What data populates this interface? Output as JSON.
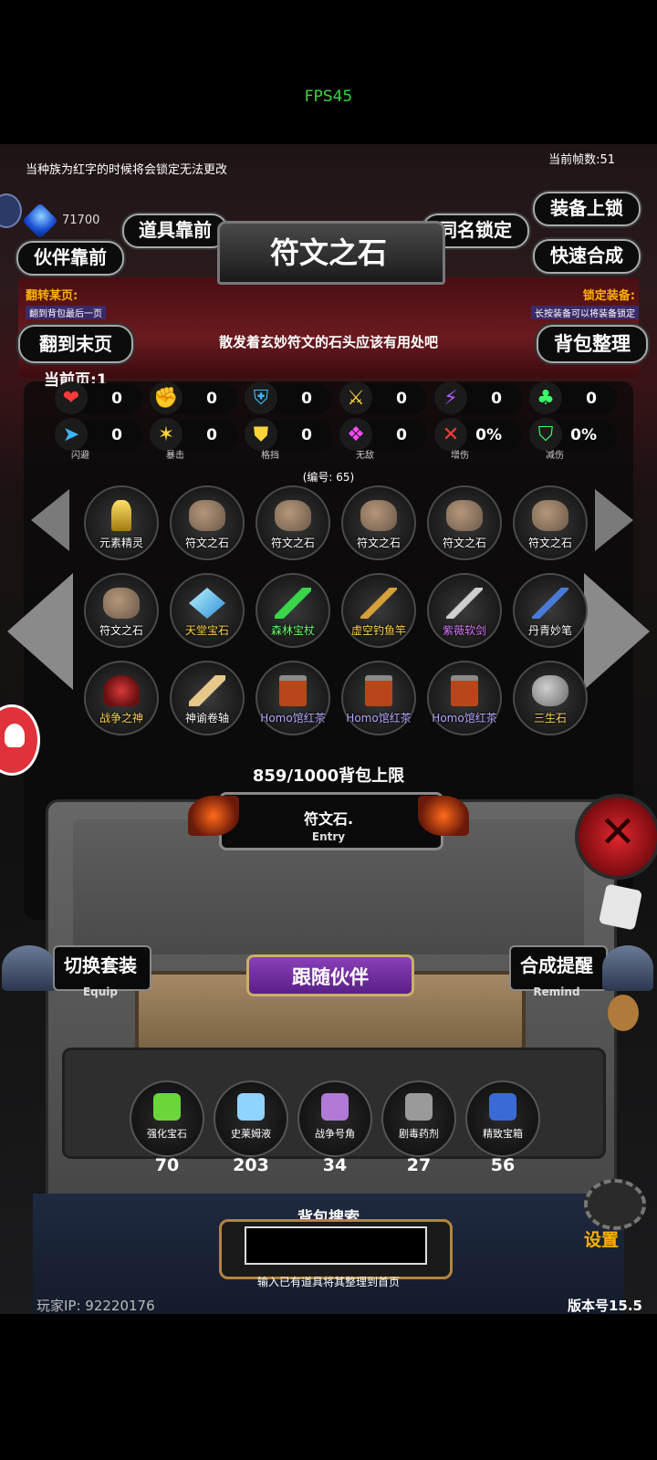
{
  "status": {
    "fps": "FPS45"
  },
  "header": {
    "notice": "当种族为红字的时候将会锁定无法更改",
    "frame_count": "当前帧数:51",
    "gem_count": "71700",
    "title": "符文之石"
  },
  "buttons": {
    "items_front": "道具靠前",
    "partner_front": "伙伴靠前",
    "same_name_lock": "同名锁定",
    "equip_lock": "装备上锁",
    "quick_merge": "快速合成",
    "go_last_page": "翻到末页",
    "bag_sort": "背包整理",
    "switch_set": "切换套装",
    "switch_set_sub": "Equip",
    "merge_remind": "合成提醒",
    "merge_remind_sub": "Remind",
    "follow_partner": "跟随伙伴",
    "settings": "设置"
  },
  "info": {
    "flip_title": "翻转某页:",
    "flip_sub": "翻到背包最后一页",
    "lock_title": "锁定装备:",
    "lock_sub": "长按装备可以将装备锁定",
    "description": "散发着玄妙符文的石头应该有用处吧",
    "current_page": "当前页:1",
    "item_number": "(编号:   65)"
  },
  "stats": [
    {
      "icon": "heart-icon",
      "value": "0",
      "caption": ""
    },
    {
      "icon": "strength-icon",
      "value": "0",
      "caption": ""
    },
    {
      "icon": "armor-icon",
      "value": "0",
      "caption": ""
    },
    {
      "icon": "sword-icon",
      "value": "0",
      "caption": ""
    },
    {
      "icon": "lightning-icon",
      "value": "0",
      "caption": ""
    },
    {
      "icon": "clover-icon",
      "value": "0",
      "caption": ""
    },
    {
      "icon": "dodge-icon",
      "value": "0",
      "caption": "闪避"
    },
    {
      "icon": "crit-icon",
      "value": "0",
      "caption": "暴击"
    },
    {
      "icon": "shield-icon",
      "value": "0",
      "caption": "格挡"
    },
    {
      "icon": "invincible-icon",
      "value": "0",
      "caption": "无敌"
    },
    {
      "icon": "damage-up-icon",
      "value": "0%",
      "caption": "增伤"
    },
    {
      "icon": "damage-reduce-icon",
      "value": "0%",
      "caption": "减伤"
    }
  ],
  "items": [
    {
      "name": "元素精灵",
      "color": "#ffffff",
      "art": "spirit"
    },
    {
      "name": "符文之石",
      "color": "#ffffff",
      "art": "rock"
    },
    {
      "name": "符文之石",
      "color": "#ffffff",
      "art": "rock"
    },
    {
      "name": "符文之石",
      "color": "#ffffff",
      "art": "rock"
    },
    {
      "name": "符文之石",
      "color": "#ffffff",
      "art": "rock"
    },
    {
      "name": "符文之石",
      "color": "#ffffff",
      "art": "rock"
    },
    {
      "name": "符文之石",
      "color": "#ffffff",
      "art": "rock"
    },
    {
      "name": "天堂宝石",
      "color": "#ffd54a",
      "art": "gem"
    },
    {
      "name": "森林宝杖",
      "color": "#6dff6d",
      "art": "staff"
    },
    {
      "name": "虚空钓鱼竿",
      "color": "#ffd54a",
      "art": "rod"
    },
    {
      "name": "紫薇软剑",
      "color": "#d77cff",
      "art": "sword"
    },
    {
      "name": "丹青妙笔",
      "color": "#ffffff",
      "art": "brush"
    },
    {
      "name": "战争之神",
      "color": "#ffd54a",
      "art": "god"
    },
    {
      "name": "神谕卷轴",
      "color": "#ffffff",
      "art": "scroll"
    },
    {
      "name": "Homo馆红茶",
      "color": "#b9a8ff",
      "art": "tea"
    },
    {
      "name": "Homo馆红茶",
      "color": "#b9a8ff",
      "art": "tea"
    },
    {
      "name": "Homo馆红茶",
      "color": "#b9a8ff",
      "art": "tea"
    },
    {
      "name": "三生石",
      "color": "#ffd54a",
      "art": "stone"
    }
  ],
  "capacity": "859/1000背包上限",
  "selected": {
    "name": "符文石.",
    "sub": "Entry"
  },
  "materials": [
    {
      "name": "强化宝石",
      "count": "70",
      "icon": "green-gem-icon"
    },
    {
      "name": "史莱姆液",
      "count": "203",
      "icon": "potion-icon"
    },
    {
      "name": "战争号角",
      "count": "34",
      "icon": "horn-icon"
    },
    {
      "name": "剧毒药剂",
      "count": "27",
      "icon": "poison-icon"
    },
    {
      "name": "精致宝箱",
      "count": "56",
      "icon": "chest-icon"
    }
  ],
  "search": {
    "title": "背包搜索",
    "value": "",
    "hint": "输入已有道具将其整理到首页"
  },
  "footer": {
    "player_ip": "玩家IP:   92220176",
    "version": "版本号15.5"
  },
  "colors": {
    "accent_gold": "#ffb000",
    "panel_red": "#5a1016",
    "fps_green": "#3ed43e"
  }
}
